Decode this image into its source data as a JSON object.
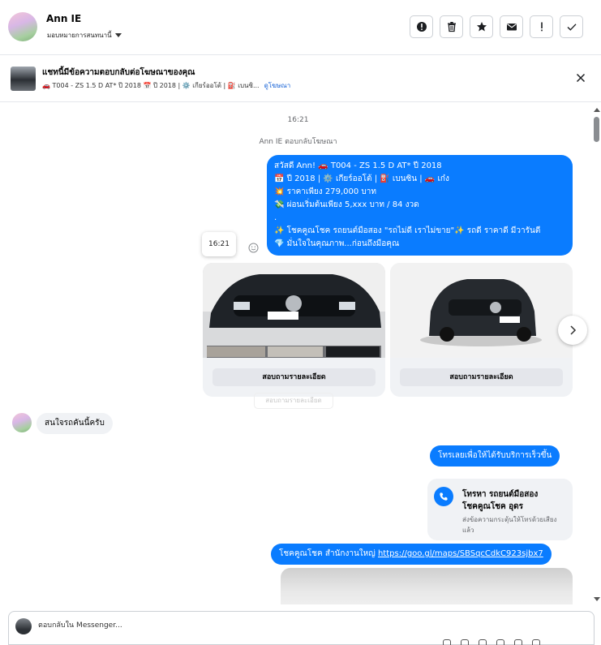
{
  "header": {
    "name": "Ann IE",
    "assign_label": "มอบหมายการสนทนานี้"
  },
  "toolbar": {
    "icons": [
      "alert-circle-icon",
      "trash-icon",
      "star-icon",
      "envelope-icon",
      "exclamation-icon",
      "check-icon"
    ]
  },
  "ad_banner": {
    "title": "แชทนี้มีข้อความตอบกลับต่อโฆษณาของคุณ",
    "subtitle": "🚗 T004 - ZS 1.5 D AT* ปี 2018 📅 ปี 2018 | ⚙️ เกียร์ออโต้ | ⛽ เบนซิ...",
    "link": "ดูโฆษณา"
  },
  "chat": {
    "timestamp": "16:21",
    "reply_notice": "Ann IE ตอบกลับโฆษณา",
    "ad_message_lines": [
      "สวัสดี Ann! 🚗 T004 - ZS 1.5 D AT* ปี 2018",
      "📅 ปี 2018 | ⚙️ เกียร์ออโต้ | ⛽ เบนซิน | 🚗 เก๋ง",
      "💥 ราคาเพียง 279,000 บาท",
      "💸 ผ่อนเริ่มต้นเพียง 5,xxx บาท / 84 งวด",
      ".",
      "✨ โชคคูณโชค รถยนต์มือสอง \"รถไม่ดี เราไม่ขาย\"✨ รถดี ราคาดี มีวารันตี",
      "💎 มั่นใจในคุณภาพ...ก่อนถึงมือคุณ"
    ],
    "tooltip_time": "16:21",
    "cards": [
      {
        "button": "สอบถามรายละเอียด"
      },
      {
        "button": "สอบถามรายละเอียด"
      }
    ],
    "ghost_button": "สอบถามรายละเอียด",
    "incoming_message": "สนใจรถคันนี้ครับ",
    "outgoing_call_prompt": "โทรเลยเพื่อให้ได้รับบริการเร็วขึ้น",
    "call_card": {
      "title_line1": "โทรหา รถยนต์มือสอง",
      "title_line2": "โชคคูณโชค อุดร",
      "subtitle": "ส่งข้อความกระตุ้นให้โทรด้วยเสียงแล้ว"
    },
    "map_message": {
      "text": "โชคคูณโชค สำนักงานใหญ่ ",
      "link": "https://goo.gl/maps/SBSqcCdkC923sjbx7"
    }
  },
  "composer": {
    "placeholder": "ตอบกลับใน Messenger..."
  },
  "colors": {
    "accent": "#0a7cff",
    "incoming_bubble": "#f0f2f5",
    "link": "#1461d6"
  }
}
